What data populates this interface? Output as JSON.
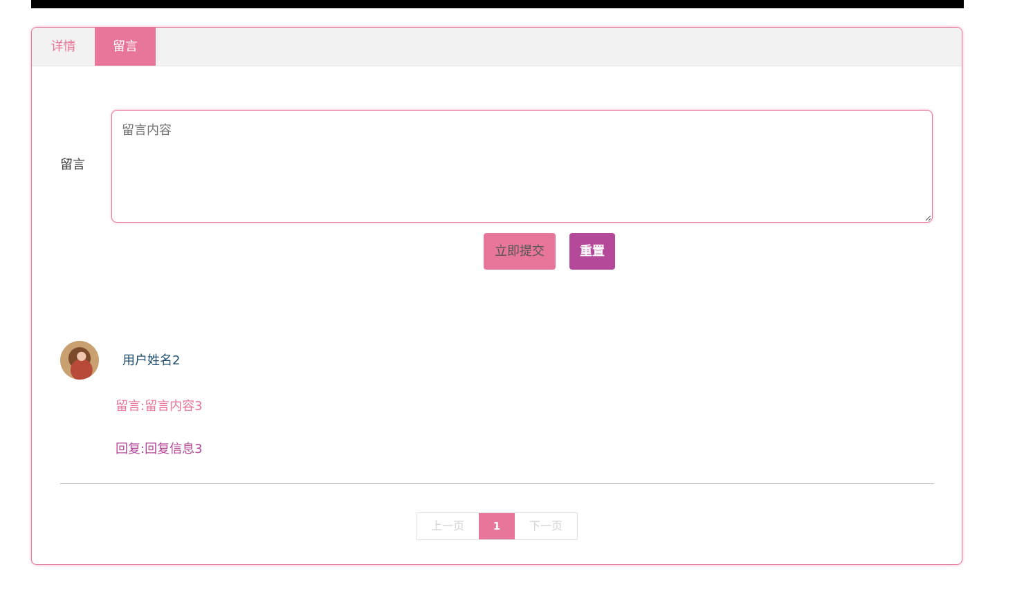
{
  "tabs": [
    {
      "label": "详情",
      "active": false
    },
    {
      "label": "留言",
      "active": true
    }
  ],
  "form": {
    "label": "留言",
    "placeholder": "留言内容",
    "value": "",
    "submit_label": "立即提交",
    "reset_label": "重置"
  },
  "comments": [
    {
      "user_name": "用户姓名2",
      "message": "留言:留言内容3",
      "reply": "回复:回复信息3"
    }
  ],
  "pagination": {
    "prev_label": "上一页",
    "current_page": "1",
    "next_label": "下一页"
  },
  "colors": {
    "accent": "#e8769a",
    "secondary": "#b4499a",
    "username": "#1f4e6e",
    "top_bar": "#000000"
  },
  "icons": {
    "resize_grip": "resize-grip-icon"
  }
}
